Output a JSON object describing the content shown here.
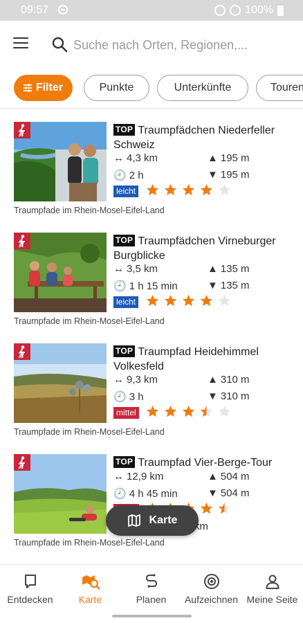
{
  "status_bar": {
    "time": "09:57",
    "battery": "100%"
  },
  "search": {
    "placeholder": "Suche nach Orten, Regionen,..."
  },
  "chips": {
    "filter": "Filter",
    "items": [
      "Punkte",
      "Unterkünfte",
      "Touren"
    ]
  },
  "badges": {
    "top": "TOP"
  },
  "tours": [
    {
      "title": "Traumpfädchen Niederfeller Schweiz",
      "distance": "4,3 km",
      "duration": "2 h",
      "ascent": "195 m",
      "descent": "195 m",
      "difficulty": "leicht",
      "rating": 4,
      "region": "Traumpfade im Rhein-Mosel-Eifel-Land"
    },
    {
      "title": "Traumpfädchen Virneburger Burgblicke",
      "distance": "3,5 km",
      "duration": "1 h 15 min",
      "ascent": "135 m",
      "descent": "135 m",
      "difficulty": "leicht",
      "rating": 4,
      "region": "Traumpfade im Rhein-Mosel-Eifel-Land"
    },
    {
      "title": "Traumpfad Heidehimmel Volkesfeld",
      "distance": "9,3 km",
      "duration": "3 h",
      "ascent": "310 m",
      "descent": "310 m",
      "difficulty": "mittel",
      "rating": 3.5,
      "region": "Traumpfade im Rhein-Mosel-Eifel-Land"
    },
    {
      "title": "Traumpfad Vier-Berge-Tour",
      "distance": "12,9 km",
      "duration": "4 h 45 min",
      "ascent": "504 m",
      "descent": "504 m",
      "difficulty": "mittel",
      "rating": 4.5,
      "region": "Traumpfade im Rhein-Mosel-Eifel-Land",
      "partial_text": "km"
    }
  ],
  "floating_button": {
    "label": "Karte",
    "icon": "map-icon"
  },
  "bottom_nav": [
    {
      "label": "Entdecken",
      "icon": "explore-icon",
      "active": false
    },
    {
      "label": "Karte",
      "icon": "map-search-icon",
      "active": true
    },
    {
      "label": "Planen",
      "icon": "route-icon",
      "active": false
    },
    {
      "label": "Aufzeichnen",
      "icon": "record-icon",
      "active": false
    },
    {
      "label": "Meine Seite",
      "icon": "profile-icon",
      "active": false
    }
  ],
  "colors": {
    "accent": "#f07c0f",
    "hike_badge": "#c8263a",
    "leicht": "#1e5bb8",
    "mittel": "#c8263a",
    "star_filled": "#f07c0f",
    "star_empty": "#e6e6e6"
  }
}
